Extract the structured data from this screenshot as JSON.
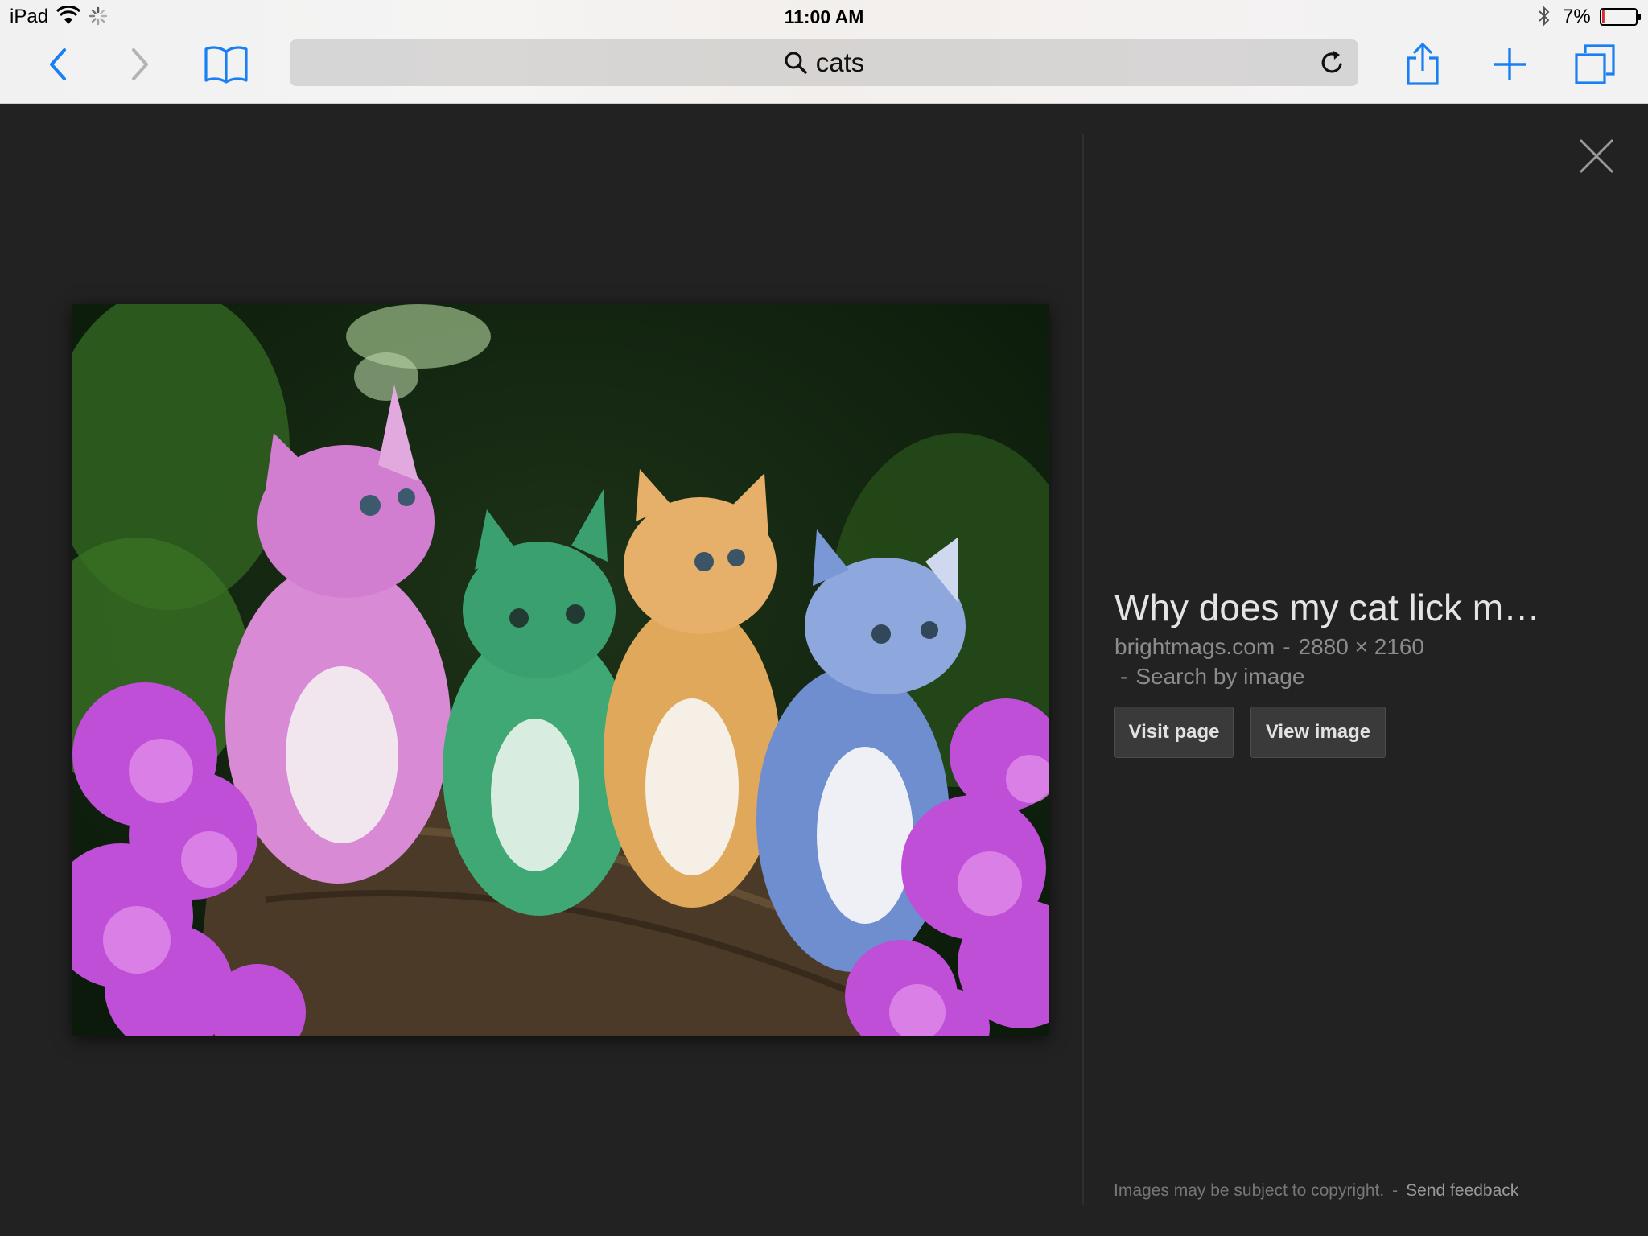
{
  "status_bar": {
    "device": "iPad",
    "time": "11:00 AM",
    "battery_percent": "7%",
    "battery_level": 0.07,
    "icons": [
      "wifi-icon",
      "activity-spinner-icon",
      "bluetooth-icon",
      "battery-icon"
    ]
  },
  "toolbar": {
    "address_text": "cats",
    "icons": [
      "back-chevron-icon",
      "forward-chevron-icon",
      "bookmarks-book-icon",
      "search-icon",
      "reload-icon",
      "share-icon",
      "plus-icon",
      "tabs-icon"
    ]
  },
  "viewer": {
    "title": "Why does my cat lick m…",
    "source": "brightmags.com",
    "dimensions": "2880 × 2160",
    "meta_separator": "-",
    "search_by_image": "Search by image",
    "visit_page": "Visit page",
    "view_image": "View image",
    "close_icon": "close-icon"
  },
  "footer": {
    "copyright": "Images may be subject to copyright.",
    "separator": "-",
    "feedback": "Send feedback"
  },
  "colors": {
    "accent": "#1a7ff2",
    "viewer_background": "#222222",
    "battery_low": "#e0292a"
  }
}
